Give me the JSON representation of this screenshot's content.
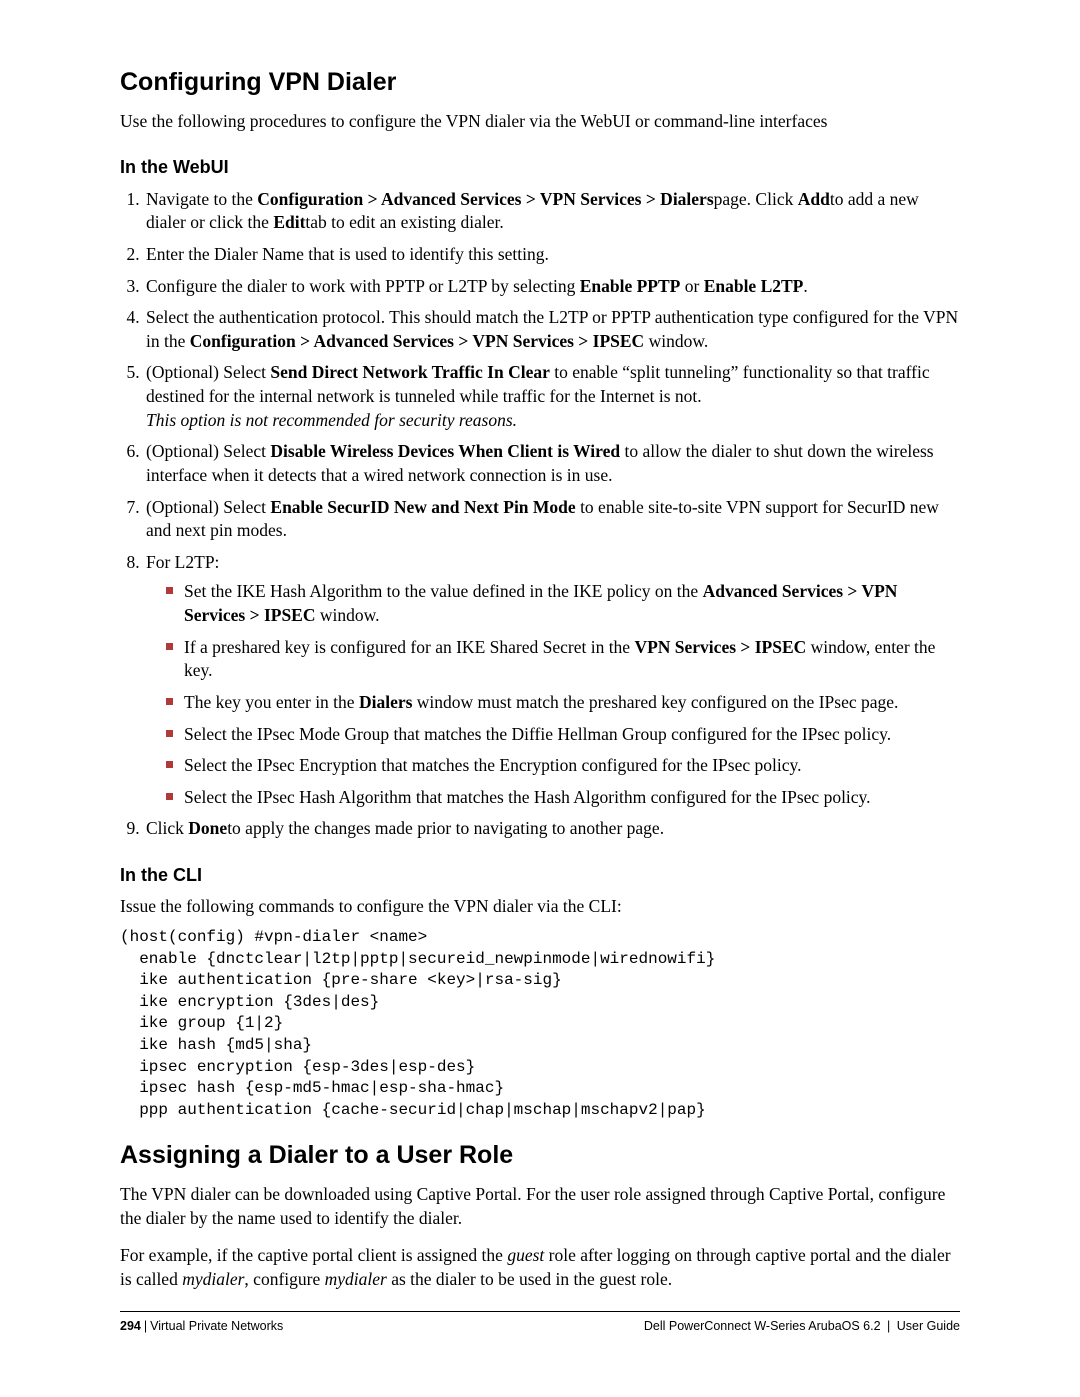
{
  "section1": {
    "title": "Configuring VPN Dialer",
    "intro": "Use the following procedures to configure the VPN dialer via the WebUI or command-line interfaces",
    "webui_heading": "In the WebUI",
    "step1_a": "Navigate to the ",
    "step1_b_bold": "Configuration > Advanced Services > VPN Services > Dialers",
    "step1_c": "page. Click ",
    "step1_d_bold": "Add",
    "step1_e": "to add a new dialer or click the ",
    "step1_f_bold": "Edit",
    "step1_g": "tab to edit an existing dialer.",
    "step2": "Enter the Dialer Name that is used to identify this setting.",
    "step3_a": "Configure the dialer to work with PPTP or L2TP by selecting ",
    "step3_b_bold": "Enable PPTP",
    "step3_c": " or ",
    "step3_d_bold": "Enable L2TP",
    "step3_e": ".",
    "step4_a": "Select the authentication protocol. This should match the L2TP or PPTP authentication type configured for the VPN in the ",
    "step4_b_bold": "Configuration > Advanced Services > VPN Services > IPSEC",
    "step4_c": " window.",
    "step5_a": "(Optional) Select ",
    "step5_b_bold": "Send Direct Network Traffic In Clear",
    "step5_c": " to enable “split tunneling” functionality so that traffic destined for the internal network is tunneled while traffic for the Internet is not.",
    "step5_note_italic": "This option is not recommended for security reasons.",
    "step6_a": "(Optional) Select ",
    "step6_b_bold": "Disable Wireless Devices When Client is Wired",
    "step6_c": " to allow the dialer to shut down the wireless interface when it detects that a wired network connection is in use.",
    "step7_a": "(Optional) Select ",
    "step7_b_bold": "Enable SecurID New and Next Pin Mode",
    "step7_c": " to enable site-to-site VPN support for SecurID new and next pin modes.",
    "step8_a": "For L2TP:",
    "step8_sub1_a": "Set the IKE Hash Algorithm to the value defined in the IKE policy on the ",
    "step8_sub1_b_bold": "Advanced Services > VPN Services > IPSEC",
    "step8_sub1_c": " window.",
    "step8_sub2_a": "If a preshared key is configured for an IKE Shared Secret in the ",
    "step8_sub2_b_bold": "VPN Services > IPSEC",
    "step8_sub2_c": " window, enter the key.",
    "step8_sub3_a": "The key you enter in the ",
    "step8_sub3_b_bold": "Dialers",
    "step8_sub3_c": " window must match the preshared key configured on the IPsec page.",
    "step8_sub4": "Select the IPsec Mode Group that matches the Diffie Hellman Group configured for the IPsec policy.",
    "step8_sub5": "Select the IPsec Encryption that matches the Encryption configured for the IPsec policy.",
    "step8_sub6": "Select the IPsec Hash Algorithm that matches the Hash Algorithm configured for the IPsec policy.",
    "step9_a": "Click ",
    "step9_b_bold": "Done",
    "step9_c": "to apply the changes made prior to navigating to another page.",
    "cli_heading": "In the CLI",
    "cli_intro": "Issue the following commands to configure the VPN dialer via the CLI:",
    "cli_code": "(host(config) #vpn-dialer <name>\n  enable {dnctclear|l2tp|pptp|secureid_newpinmode|wirednowifi}\n  ike authentication {pre-share <key>|rsa-sig}\n  ike encryption {3des|des}\n  ike group {1|2}\n  ike hash {md5|sha}\n  ipsec encryption {esp-3des|esp-des}\n  ipsec hash {esp-md5-hmac|esp-sha-hmac}\n  ppp authentication {cache-securid|chap|mschap|mschapv2|pap}"
  },
  "section2": {
    "title": "Assigning a Dialer to a User Role",
    "p1": "The VPN dialer can be downloaded using Captive Portal. For the user role assigned through Captive Portal, configure the dialer by the name used to identify the dialer.",
    "p2_a": "For example, if the captive portal client is assigned the ",
    "p2_b_italic": "guest",
    "p2_c": " role after logging on through captive portal and the dialer is called ",
    "p2_d_italic": "mydialer",
    "p2_e": ", configure ",
    "p2_f_italic": "mydialer",
    "p2_g": " as the dialer to be used in the guest role."
  },
  "footer": {
    "page_number": "294",
    "chapter": "Virtual Private Networks",
    "product": "Dell PowerConnect W-Series ArubaOS 6.2",
    "doc": "User Guide"
  }
}
